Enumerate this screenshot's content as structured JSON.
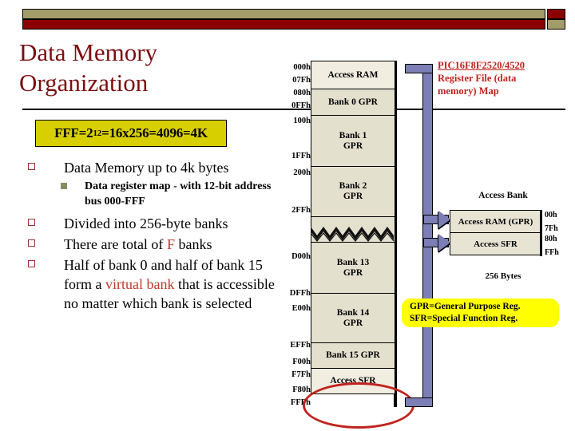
{
  "banner": {
    "olive_color": "#a39b69",
    "maroon_color": "#8b0000"
  },
  "slide": {
    "title_line1": "Data Memory",
    "title_line2": "Organization",
    "title_color": "#7b0f12"
  },
  "formula": {
    "prefix": "FFF=2",
    "exponent": "12",
    "suffix": "=16x256=4096=4K",
    "background": "#d8cf00"
  },
  "bullets": [
    {
      "level": 1,
      "text": "Data Memory up to 4k bytes",
      "sub": [
        {
          "level": 2,
          "text": "Data register map  - with 12-bit address bus  000-FFF"
        }
      ]
    },
    {
      "level": 1,
      "text": "Divided into 256-byte banks"
    },
    {
      "level": 1,
      "text_a": "There are total of ",
      "highlight": "F",
      "text_b": " banks"
    },
    {
      "level": 1,
      "text_a": "Half of bank 0 and half of bank 15 form a ",
      "highlight": "virtual bank",
      "text_b": " that is accessible no matter which bank is selected"
    }
  ],
  "memory_map": {
    "title_line1": "PIC16F8F2520/4520",
    "title_line2": "Register File (data",
    "title_line3": "memory) Map",
    "title_color": "#c0241f",
    "cells": [
      {
        "label": "Access RAM",
        "shade": "light"
      },
      {
        "label": "Bank 0 GPR",
        "shade": "normal"
      },
      {
        "label": "Bank 1\nGPR",
        "shade": "normal"
      },
      {
        "label": "Bank 2\nGPR",
        "shade": "normal"
      },
      {
        "label": "",
        "shade": "normal"
      },
      {
        "label": "Bank 13\nGPR",
        "shade": "normal"
      },
      {
        "label": "Bank 14\nGPR",
        "shade": "normal"
      },
      {
        "label": "Bank 15 GPR",
        "shade": "normal"
      },
      {
        "label": "Access SFR",
        "shade": "light"
      }
    ],
    "addresses": [
      "000h",
      "07Fh",
      "080h",
      "0FFh",
      "100h",
      "1FFh",
      "200h",
      "2FFh",
      "D00h",
      "DFFh",
      "E00h",
      "EFFh",
      "F00h",
      "F7Fh",
      "F80h",
      "FFFh"
    ]
  },
  "access_bank": {
    "title": "Access Bank",
    "rows": [
      {
        "label": "Access RAM (GPR)",
        "start": "00h",
        "end": "7Fh"
      },
      {
        "label": "Access SFR",
        "start": "80h",
        "end": "FFh"
      }
    ],
    "size": "256 Bytes"
  },
  "legend": {
    "line1": "GPR=General Purpose Reg.",
    "line2": "SFR=Special Function Reg.",
    "background": "#ffff00"
  }
}
